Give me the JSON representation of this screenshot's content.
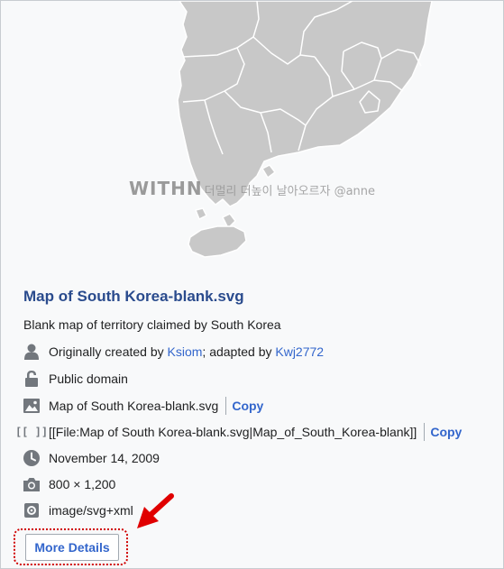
{
  "map": {
    "watermark_logo": "WITHN",
    "watermark_text": "더멀리 더높이 날아오르자 @anne"
  },
  "file": {
    "title": "Map of South Korea-blank.svg",
    "description": "Blank map of territory claimed by South Korea"
  },
  "details": {
    "author_prefix": "Originally created by ",
    "author_1": "Ksiom",
    "author_mid": "; adapted by ",
    "author_2": "Kwj2772",
    "license": "Public domain",
    "filename": "Map of South Korea-blank.svg",
    "wikitext": "[[File:Map of South Korea-blank.svg|Map_of_South_Korea-blank]]",
    "copy_label": "Copy",
    "date": "November 14, 2009",
    "dimensions": "800 × 1,200",
    "mime": "image/svg+xml"
  },
  "more_details_label": "More Details",
  "icons": {
    "author": "user-icon",
    "license": "unlock-icon",
    "image": "image-icon",
    "wikitext": "wikitext-icon",
    "date": "clock-icon",
    "dimensions": "camera-icon",
    "mime": "settings-icon"
  },
  "colors": {
    "map_fill": "#c8c8c8",
    "link": "#3366cc",
    "title": "#2a4b8d",
    "highlight": "#d00000"
  }
}
